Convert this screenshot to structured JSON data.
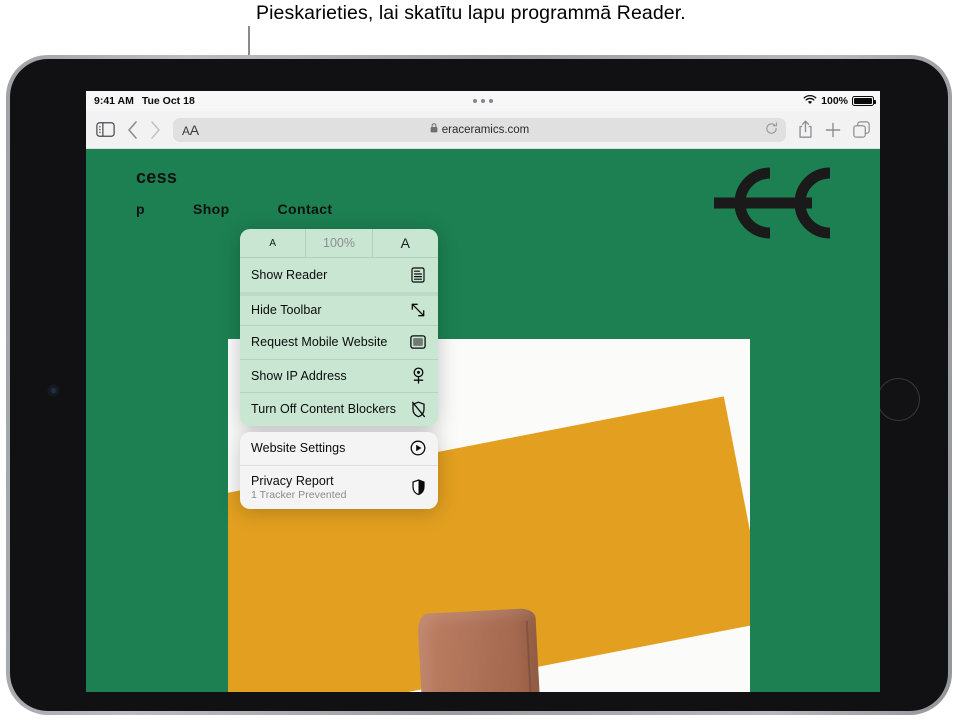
{
  "caption": {
    "text": "Pieskarieties, lai skatītu lapu programmā Reader."
  },
  "status_bar": {
    "time": "9:41 AM",
    "date": "Tue Oct 18",
    "battery_percent": "100%",
    "wifi_icon": "wifi-icon",
    "battery_icon": "battery-full-icon",
    "multitask_handle": "multitask-dots-icon"
  },
  "toolbar": {
    "sidebar_icon": "sidebar-icon",
    "back_icon": "chevron-left-icon",
    "forward_icon": "chevron-right-icon",
    "aa_label_small": "A",
    "aa_label_large": "A",
    "lock_icon": "lock-icon",
    "url": "eraceramics.com",
    "reload_icon": "reload-icon",
    "share_icon": "share-icon",
    "new_tab_icon": "plus-icon",
    "tabs_icon": "tabs-icon"
  },
  "aa_menu": {
    "zoom_row": {
      "decrease_label": "A",
      "percent": "100%",
      "increase_label": "A"
    },
    "green_items": [
      {
        "label": "Show Reader",
        "icon": "reader-icon"
      },
      {
        "label": "Hide Toolbar",
        "icon": "hide-toolbar-icon"
      },
      {
        "label": "Request Mobile Website",
        "icon": "mobile-website-icon"
      },
      {
        "label": "Show IP Address",
        "icon": "ip-address-icon"
      },
      {
        "label": "Turn Off Content Blockers",
        "icon": "content-blocker-off-icon"
      }
    ],
    "grey_items": [
      {
        "label": "Website Settings",
        "sub": "",
        "icon": "website-settings-icon"
      },
      {
        "label": "Privacy Report",
        "sub": "1 Tracker Prevented",
        "icon": "privacy-shield-icon"
      }
    ]
  },
  "webpage": {
    "heading": "cess",
    "nav": [
      "Shop",
      "Contact"
    ],
    "nav_partial": "p",
    "logo_icon": "ec-monogram-logo"
  },
  "colors": {
    "brand_green": "#1c8052",
    "menu_green": "#c9e6d2",
    "menu_grey": "#f4f4f4",
    "clay_orange": "#e3a020"
  }
}
